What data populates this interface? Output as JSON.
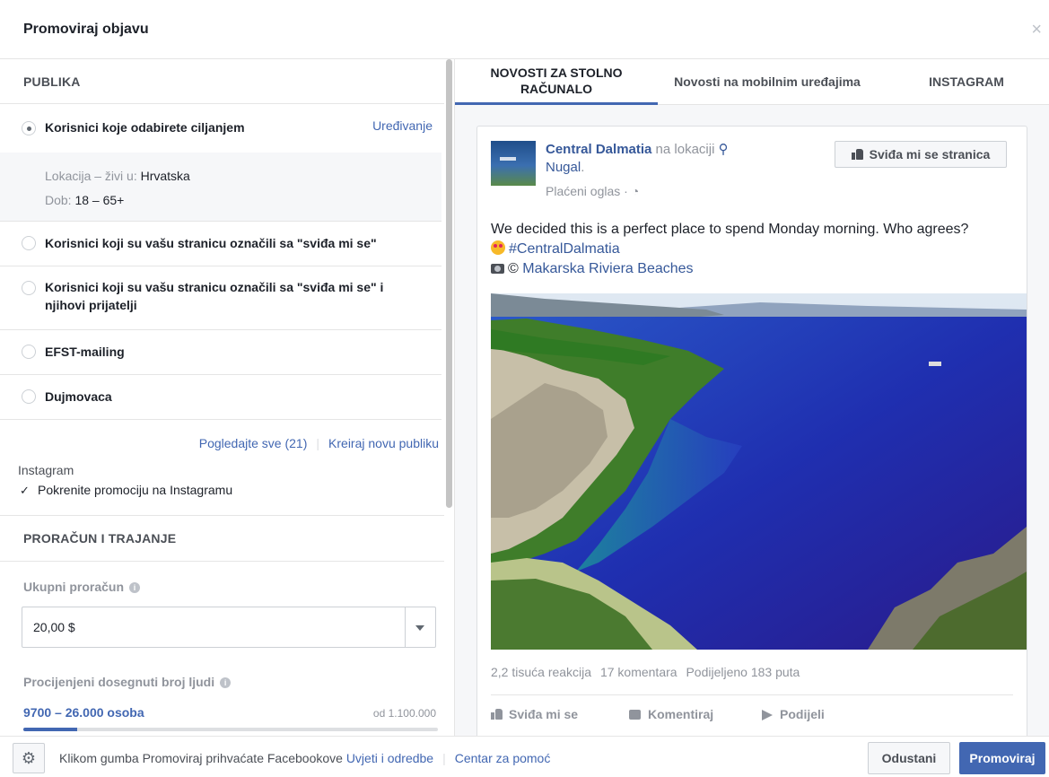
{
  "dialog": {
    "title": "Promoviraj objavu",
    "close_symbol": "×"
  },
  "audience": {
    "heading": "PUBLIKA",
    "options": [
      {
        "label": "Korisnici koje odabirete ciljanjem",
        "selected": true
      },
      {
        "label": "Korisnici koji su vašu stranicu označili sa \"sviđa mi se\"",
        "selected": false
      },
      {
        "label_line1": "Korisnici koji su vašu stranicu označili sa \"sviđa mi se\" i",
        "label_line2": "njihovi prijatelji",
        "selected": false
      },
      {
        "label": "EFST-mailing",
        "selected": false
      },
      {
        "label": "Dujmovaca",
        "selected": false
      }
    ],
    "edit_label": "Uređivanje",
    "location_prefix": "Lokacija – živi u: ",
    "location_value": "Hrvatska",
    "age_prefix": "Dob: ",
    "age_value": "18 – 65+",
    "see_all": "Pogledajte sve (21)",
    "create_new": "Kreiraj novu publiku",
    "instagram_label": "Instagram",
    "instagram_checkbox": "Pokrenite promociju na Instagramu",
    "instagram_checked": true
  },
  "budget": {
    "heading": "PRORAČUN I TRAJANJE",
    "total_label": "Ukupni proračun",
    "total_value": "20,00 $",
    "reach_label": "Procijenjeni dosegnuti broj ljudi",
    "reach_value": "9700 – 26.000 osoba",
    "reach_of": "od 1.100.000",
    "reach_fraction": 0.13
  },
  "preview": {
    "tabs": [
      {
        "line1": "NOVOSTI ZA STOLNO",
        "line2": "RAČUNALO",
        "active": true
      },
      {
        "label": "Novosti na mobilnim uređajima",
        "active": false
      },
      {
        "label": "INSTAGRAM",
        "active": false
      }
    ],
    "post": {
      "page_name": "Central Dalmatia",
      "at_location": " na lokaciji ",
      "location": "Nugal",
      "location_suffix": ".",
      "sponsored": "Plaćeni oglas · ",
      "like_page": "Sviđa mi se stranica",
      "text": "We decided this is a perfect place to spend Monday morning. Who agrees?",
      "hashtag": "#CentralDalmatia",
      "credit_prefix": "© ",
      "credit": "Makarska Riviera Beaches",
      "reactions": "2,2 tisuća reakcija",
      "comments": "17 komentara",
      "shares": "Podijeljeno 183 puta",
      "action_like": "Sviđa mi se",
      "action_comment": "Komentiraj",
      "action_share": "Podijeli"
    }
  },
  "footer": {
    "text": "Klikom gumba Promoviraj prihvaćate Facebookove ",
    "terms": "Uvjeti i odredbe",
    "separator": "|",
    "help": "Centar za pomoć",
    "cancel": "Odustani",
    "promote": "Promoviraj"
  },
  "colors": {
    "accent": "#4267b2",
    "link": "#365899",
    "muted": "#90949c"
  }
}
